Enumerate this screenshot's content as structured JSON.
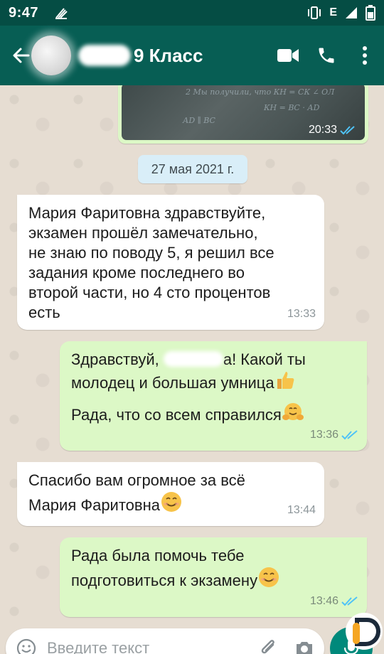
{
  "status_bar": {
    "time": "9:47",
    "network_label": "E"
  },
  "header": {
    "chat_title": "9 Класс"
  },
  "image_message": {
    "time": "20:33",
    "handwriting": [
      "2 Мы получили, что КН = СК ∠ ОЛ",
      "КН = ВС · АD",
      "АD ∥ BC"
    ]
  },
  "date_divider": "27 мая 2021 г.",
  "messages": [
    {
      "direction": "in",
      "text": "Мария Фаритовна здравствуйте,\nэкзамен прошёл замечательно,\nне знаю по поводу 5, я решил все\nзадания кроме последнего во\nвторой части, но 4 сто процентов\nесть",
      "time": "13:33"
    },
    {
      "direction": "out",
      "text_before": "Здравствуй, ",
      "text_after": "а! Какой ты\nмолодец и большая умница",
      "text_line3": "Рада, что со всем справился",
      "time": "13:36"
    },
    {
      "direction": "in",
      "text": "Спасибо вам огромное за всё\nМария Фаритовна",
      "time": "13:44"
    },
    {
      "direction": "out",
      "text": "Рада была помочь тебе\nподготовиться к экзамену",
      "time": "13:46"
    }
  ],
  "input": {
    "placeholder": "Введите текст"
  },
  "icons": [
    "notification-icon",
    "vibrate-icon",
    "signal-icon",
    "battery-icon",
    "back-arrow-icon",
    "video-call-icon",
    "phone-icon",
    "more-options-icon",
    "double-check-icon",
    "thumbs-up-emoji",
    "hugging-emoji",
    "smiling-emoji",
    "emoji-icon",
    "attach-icon",
    "camera-icon",
    "mic-icon"
  ],
  "colors": {
    "header": "#075e54",
    "status_bar": "#054d44",
    "outgoing_bubble": "#dcf8c6",
    "incoming_bubble": "#ffffff",
    "read_ticks": "#4fc3f7",
    "date_chip": "#d9eef8"
  }
}
